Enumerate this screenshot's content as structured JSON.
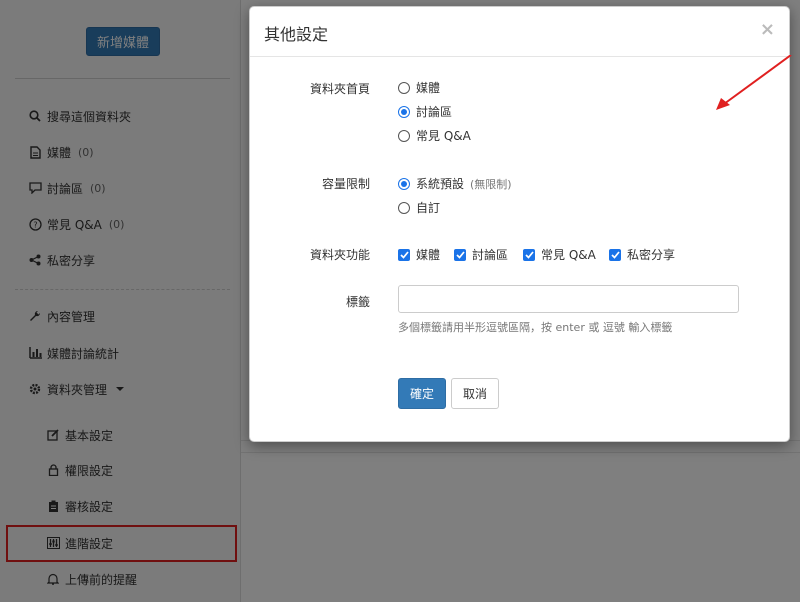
{
  "sidebar": {
    "new_media_button": "新增媒體",
    "items": [
      {
        "label": "搜尋這個資料夾",
        "count": ""
      },
      {
        "label": "媒體",
        "count": "(0)"
      },
      {
        "label": "討論區",
        "count": "(0)"
      },
      {
        "label": "常見 Q&A",
        "count": "(0)"
      },
      {
        "label": "私密分享",
        "count": ""
      }
    ],
    "admin_items": [
      {
        "label": "內容管理"
      },
      {
        "label": "媒體討論統計"
      },
      {
        "label": "資料夾管理"
      }
    ],
    "sub_items": [
      {
        "label": "基本設定"
      },
      {
        "label": "權限設定"
      },
      {
        "label": "審核設定"
      },
      {
        "label": "進階設定"
      },
      {
        "label": "上傳前的提醒"
      }
    ]
  },
  "modal": {
    "title": "其他設定",
    "close_label": "×",
    "homepage": {
      "label": "資料夾首頁",
      "options": [
        {
          "label": "媒體",
          "selected": false
        },
        {
          "label": "討論區",
          "selected": true
        },
        {
          "label": "常見 Q&A",
          "selected": false
        }
      ]
    },
    "quota": {
      "label": "容量限制",
      "options": [
        {
          "label": "系統預設",
          "note": "(無限制)",
          "selected": true
        },
        {
          "label": "自訂",
          "note": "",
          "selected": false
        }
      ]
    },
    "features": {
      "label": "資料夾功能",
      "options": [
        {
          "label": "媒體",
          "checked": true
        },
        {
          "label": "討論區",
          "checked": true
        },
        {
          "label": "常見 Q&A",
          "checked": true
        },
        {
          "label": "私密分享",
          "checked": true
        }
      ]
    },
    "tags": {
      "label": "標籤",
      "value": "",
      "help": "多個標籤請用半形逗號區隔，按 enter 或 逗號 輸入標籤"
    },
    "ok_button": "確定",
    "cancel_button": "取消"
  },
  "colors": {
    "primary": "#337ab7",
    "annotation": "#e02020",
    "check": "#1a73e8"
  }
}
